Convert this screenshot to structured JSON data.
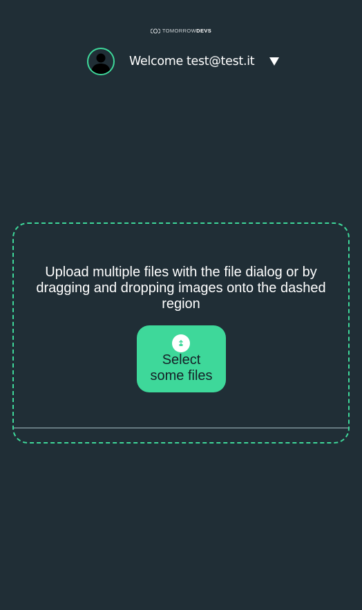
{
  "brand": {
    "logo_light": "TOMORROW",
    "logo_bold": "DEVS"
  },
  "header": {
    "welcome_label": "Welcome",
    "user_email": "test@test.it",
    "avatar_icon": "user-avatar-icon",
    "menu_icon": "caret-down-icon"
  },
  "upload": {
    "instructions": "Upload multiple files with the file dialog or by dragging and dropping images onto the dashed region",
    "select_button_line1": "Select",
    "select_button_line2": "some files",
    "button_icon": "upload-icon"
  },
  "colors": {
    "background": "#202e36",
    "accent": "#3ed89a",
    "text": "#ffffff"
  }
}
